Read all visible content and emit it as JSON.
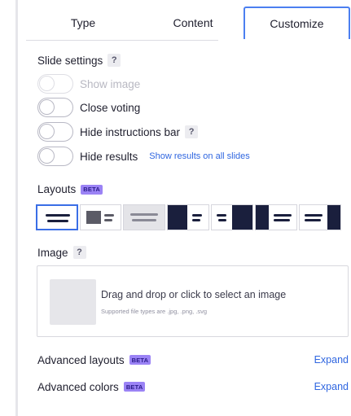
{
  "tabs": [
    {
      "label": "Type"
    },
    {
      "label": "Content"
    },
    {
      "label": "Customize",
      "active": true
    }
  ],
  "slide_settings": {
    "title": "Slide settings",
    "help": "?",
    "toggles": [
      {
        "label": "Show image",
        "on": false,
        "disabled": true
      },
      {
        "label": "Close voting",
        "on": false
      },
      {
        "label": "Hide instructions bar",
        "on": false,
        "help": "?"
      },
      {
        "label": "Hide results",
        "on": false,
        "link": "Show results on all slides"
      }
    ]
  },
  "layouts": {
    "title": "Layouts",
    "badge": "BETA",
    "options": [
      {
        "name": "centered-text",
        "selected": true
      },
      {
        "name": "image-left-small"
      },
      {
        "name": "text-only-disabled",
        "disabled": true
      },
      {
        "name": "image-left"
      },
      {
        "name": "image-right"
      },
      {
        "name": "image-right-narrow"
      },
      {
        "name": "image-right-edge"
      }
    ]
  },
  "image": {
    "title": "Image",
    "help": "?",
    "drop_text": "Drag and drop or click to select an image",
    "supported_text": "Supported file types are .jpg, .png, .svg"
  },
  "advanced_layouts": {
    "label": "Advanced layouts",
    "badge": "BETA",
    "action": "Expand"
  },
  "advanced_colors": {
    "label": "Advanced colors",
    "badge": "BETA",
    "action": "Expand"
  },
  "colors": {
    "accent": "#2f66e0",
    "beta": "#9b83f5",
    "navy": "#1a1f3d"
  }
}
